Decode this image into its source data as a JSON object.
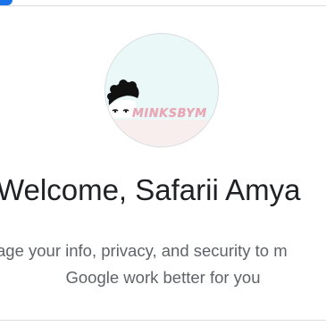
{
  "header": {
    "accent_color": "#1a73e8"
  },
  "profile": {
    "avatar_text": "MINKSBYM"
  },
  "main": {
    "welcome_text": "Welcome, Safarii Amya",
    "subtitle_line1": "age your info, privacy, and security to m",
    "subtitle_line2": "Google work better for you"
  },
  "colors": {
    "title": "#202124",
    "subtitle": "#5f6368",
    "divider": "#dadce0"
  }
}
